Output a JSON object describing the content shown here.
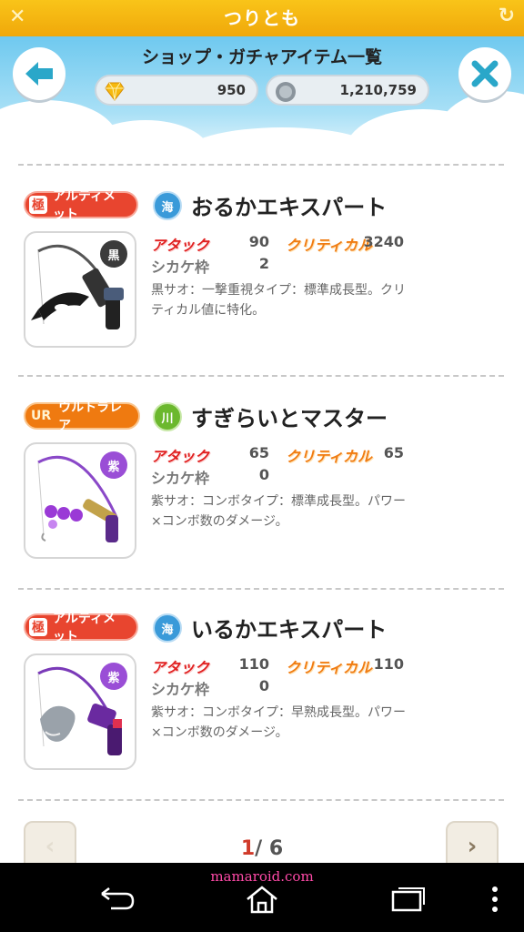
{
  "app": {
    "title": "つりとも",
    "close_icon": "close-x-icon",
    "reload_icon": "reload-icon"
  },
  "header": {
    "title": "ショップ・ガチャアイテム一覧",
    "gems": "950",
    "coins": "1,210,759"
  },
  "items": [
    {
      "rank_short": "極",
      "rank": "アルティメット",
      "rank_color": "#e8452f",
      "location": "海",
      "name": "おるかエキスパート",
      "attack_label": "アタック",
      "attack": "90",
      "critical_label": "クリティカル",
      "critical": "3240",
      "shikake_label": "シカケ枠",
      "shikake": "2",
      "color_badge": "黒",
      "desc": "黒サオ：一撃重視タイプ：標準成長型。クリティカル値に特化。"
    },
    {
      "rank_short": "UR",
      "rank": "ウルトラレア",
      "rank_color": "#ef7a10",
      "location": "川",
      "name": "すぎらいとマスター",
      "attack_label": "アタック",
      "attack": "65",
      "critical_label": "クリティカル",
      "critical": "65",
      "shikake_label": "シカケ枠",
      "shikake": "0",
      "color_badge": "紫",
      "desc": "紫サオ：コンボタイプ：標準成長型。パワー×コンボ数のダメージ。"
    },
    {
      "rank_short": "極",
      "rank": "アルティメット",
      "rank_color": "#e8452f",
      "location": "海",
      "name": "いるかエキスパート",
      "attack_label": "アタック",
      "attack": "110",
      "critical_label": "クリティカル",
      "critical": "110",
      "shikake_label": "シカケ枠",
      "shikake": "0",
      "color_badge": "紫",
      "desc": "紫サオ：コンボタイプ：早熟成長型。パワー×コンボ数のダメージ。"
    }
  ],
  "pager": {
    "current": "1",
    "total": "/ 6"
  },
  "watermark": "mamaroid.com"
}
